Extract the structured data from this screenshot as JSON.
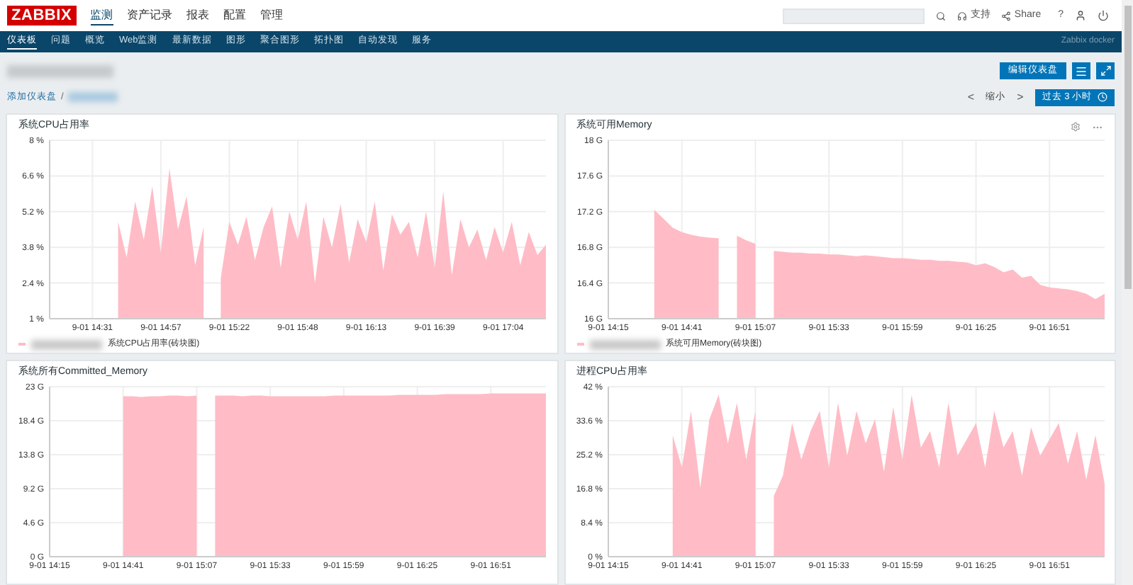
{
  "header": {
    "logo": "ZABBIX",
    "menu": [
      {
        "label": "监测",
        "selected": true
      },
      {
        "label": "资产记录",
        "selected": false
      },
      {
        "label": "报表",
        "selected": false
      },
      {
        "label": "配置",
        "selected": false
      },
      {
        "label": "管理",
        "selected": false
      }
    ],
    "support": "支持",
    "share": "Share",
    "help": "?"
  },
  "submenu": {
    "items": [
      {
        "label": "仪表板",
        "selected": true
      },
      {
        "label": "问题",
        "selected": false
      },
      {
        "label": "概览",
        "selected": false
      },
      {
        "label": "Web监测",
        "selected": false
      },
      {
        "label": "最新数据",
        "selected": false
      },
      {
        "label": "图形",
        "selected": false
      },
      {
        "label": "聚合图形",
        "selected": false
      },
      {
        "label": "拓扑图",
        "selected": false
      },
      {
        "label": "自动发现",
        "selected": false
      },
      {
        "label": "服务",
        "selected": false
      }
    ],
    "server_name": "Zabbix docker"
  },
  "toolbar": {
    "edit_button": "编辑仪表盘"
  },
  "breadcrumb": {
    "root": "添加仪表盘",
    "separator": "/"
  },
  "timeline": {
    "prev": "<",
    "zoom_out": "缩小",
    "next": ">",
    "range": "过去 3 小时"
  },
  "widgets": [
    {
      "title": "系统CPU占用率",
      "chart_data": {
        "type": "area",
        "grid": true,
        "categories": [
          null,
          null,
          null,
          null,
          null,
          "9-01 14:31",
          null,
          null,
          null,
          null,
          null,
          null,
          null,
          "9-01 14:57",
          null,
          null,
          null,
          null,
          null,
          null,
          null,
          "9-01 15:22",
          null,
          null,
          null,
          null,
          null,
          null,
          null,
          "9-01 15:48",
          null,
          null,
          null,
          null,
          null,
          null,
          null,
          "9-01 16:13",
          null,
          null,
          null,
          null,
          null,
          null,
          null,
          "9-01 16:39",
          null,
          null,
          null,
          null,
          null,
          null,
          null,
          "9-01 17:04",
          null,
          null,
          null,
          null,
          null
        ],
        "series": [
          {
            "name": "系统CPU占用率(砖块图)",
            "color": "#ffbcc6",
            "values": [
              null,
              null,
              null,
              null,
              null,
              null,
              null,
              null,
              4.8,
              3.4,
              5.6,
              4.1,
              6.2,
              3.6,
              6.9,
              4.5,
              5.8,
              3.1,
              4.6,
              null,
              2.6,
              4.8,
              3.9,
              5.0,
              3.3,
              4.6,
              5.4,
              3.0,
              5.2,
              4.1,
              5.6,
              2.4,
              5.0,
              3.8,
              5.5,
              3.2,
              4.9,
              4.0,
              5.6,
              2.9,
              5.1,
              4.3,
              4.8,
              3.4,
              5.2,
              3.0,
              6.0,
              2.7,
              4.9,
              3.8,
              4.5,
              3.3,
              4.6,
              3.6,
              4.8,
              3.1,
              4.4,
              3.5,
              3.9
            ]
          }
        ],
        "ylim": [
          1,
          8
        ],
        "yticks": [
          {
            "value": 1,
            "label": "1 %"
          },
          {
            "value": 2.4,
            "label": "2.4 %"
          },
          {
            "value": 3.8,
            "label": "3.8 %"
          },
          {
            "value": 5.2,
            "label": "5.2 %"
          },
          {
            "value": 6.6,
            "label": "6.6 %"
          },
          {
            "value": 8,
            "label": "8 %"
          }
        ]
      }
    },
    {
      "title": "系统可用Memory",
      "menu": true,
      "chart_data": {
        "type": "area",
        "grid": true,
        "categories": [
          "9-01 14:15",
          null,
          null,
          null,
          null,
          null,
          null,
          null,
          "9-01 14:41",
          null,
          null,
          null,
          null,
          null,
          null,
          null,
          "9-01 15:07",
          null,
          null,
          null,
          null,
          null,
          null,
          null,
          "9-01 15:33",
          null,
          null,
          null,
          null,
          null,
          null,
          null,
          "9-01 15:59",
          null,
          null,
          null,
          null,
          null,
          null,
          null,
          "9-01 16:25",
          null,
          null,
          null,
          null,
          null,
          null,
          null,
          "9-01 16:51",
          null,
          null,
          null,
          null,
          null,
          null
        ],
        "series": [
          {
            "name": "系统可用Memory(砖块图)",
            "color": "#ffbcc6",
            "values": [
              null,
              null,
              null,
              null,
              null,
              17.22,
              17.12,
              17.02,
              16.97,
              16.94,
              16.92,
              16.91,
              16.9,
              null,
              16.93,
              16.88,
              16.84,
              null,
              16.76,
              16.75,
              16.74,
              16.74,
              16.73,
              16.73,
              16.72,
              16.72,
              16.71,
              16.7,
              16.71,
              16.7,
              16.69,
              16.68,
              16.68,
              16.67,
              16.66,
              16.66,
              16.65,
              16.65,
              16.64,
              16.63,
              16.6,
              16.62,
              16.58,
              16.52,
              16.55,
              16.46,
              16.48,
              16.38,
              16.35,
              16.34,
              16.33,
              16.31,
              16.28,
              16.22,
              16.28
            ]
          }
        ],
        "ylim": [
          16,
          18
        ],
        "yticks": [
          {
            "value": 16,
            "label": "16 G"
          },
          {
            "value": 16.4,
            "label": "16.4 G"
          },
          {
            "value": 16.8,
            "label": "16.8 G"
          },
          {
            "value": 17.2,
            "label": "17.2 G"
          },
          {
            "value": 17.6,
            "label": "17.6 G"
          },
          {
            "value": 18,
            "label": "18 G"
          }
        ]
      }
    },
    {
      "title": "系统所有Committed_Memory",
      "chart_data": {
        "type": "area",
        "grid": true,
        "categories": [
          "9-01 14:15",
          null,
          null,
          null,
          null,
          null,
          null,
          null,
          "9-01 14:41",
          null,
          null,
          null,
          null,
          null,
          null,
          null,
          "9-01 15:07",
          null,
          null,
          null,
          null,
          null,
          null,
          null,
          "9-01 15:33",
          null,
          null,
          null,
          null,
          null,
          null,
          null,
          "9-01 15:59",
          null,
          null,
          null,
          null,
          null,
          null,
          null,
          "9-01 16:25",
          null,
          null,
          null,
          null,
          null,
          null,
          null,
          "9-01 16:51",
          null,
          null,
          null,
          null,
          null,
          null
        ],
        "series": [
          {
            "color": "#ffbcc6",
            "values": [
              null,
              null,
              null,
              null,
              null,
              null,
              null,
              null,
              21.7,
              21.7,
              21.6,
              21.7,
              21.7,
              21.8,
              21.8,
              21.7,
              21.8,
              null,
              21.8,
              21.8,
              21.8,
              21.7,
              21.8,
              21.8,
              21.7,
              21.7,
              21.7,
              21.7,
              21.7,
              21.7,
              21.7,
              21.8,
              21.8,
              21.8,
              21.8,
              21.8,
              21.8,
              21.8,
              21.9,
              21.9,
              21.9,
              21.9,
              21.9,
              22.0,
              22.0,
              22.0,
              22.0,
              22.0,
              22.1,
              22.1,
              22.1,
              22.1,
              22.1,
              22.1,
              22.1
            ]
          }
        ],
        "ylim": [
          0,
          23
        ],
        "yticks": [
          {
            "value": 0,
            "label": "0 G"
          },
          {
            "value": 4.6,
            "label": "4.6 G"
          },
          {
            "value": 9.2,
            "label": "9.2 G"
          },
          {
            "value": 13.8,
            "label": "13.8 G"
          },
          {
            "value": 18.4,
            "label": "18.4 G"
          },
          {
            "value": 23,
            "label": "23 G"
          }
        ]
      }
    },
    {
      "title": "进程CPU占用率",
      "chart_data": {
        "type": "area",
        "grid": true,
        "categories": [
          "9-01 14:15",
          null,
          null,
          null,
          null,
          null,
          null,
          null,
          "9-01 14:41",
          null,
          null,
          null,
          null,
          null,
          null,
          null,
          "9-01 15:07",
          null,
          null,
          null,
          null,
          null,
          null,
          null,
          "9-01 15:33",
          null,
          null,
          null,
          null,
          null,
          null,
          null,
          "9-01 15:59",
          null,
          null,
          null,
          null,
          null,
          null,
          null,
          "9-01 16:25",
          null,
          null,
          null,
          null,
          null,
          null,
          null,
          "9-01 16:51",
          null,
          null,
          null,
          null,
          null,
          null
        ],
        "series": [
          {
            "color": "#ffbcc6",
            "values": [
              null,
              null,
              null,
              null,
              null,
              null,
              null,
              30,
              22,
              36,
              17,
              34,
              40,
              28,
              38,
              24,
              36,
              null,
              15,
              20,
              33,
              24,
              31,
              36,
              22,
              38,
              25,
              36,
              28,
              34,
              21,
              37,
              24,
              40,
              27,
              31,
              22,
              38,
              25,
              29,
              33,
              22,
              36,
              27,
              31,
              20,
              32,
              25,
              29,
              33,
              23,
              31,
              19,
              30,
              18
            ]
          }
        ],
        "ylim": [
          0,
          42
        ],
        "yticks": [
          {
            "value": 0,
            "label": "0 %"
          },
          {
            "value": 8.4,
            "label": "8.4 %"
          },
          {
            "value": 16.8,
            "label": "16.8 %"
          },
          {
            "value": 25.2,
            "label": "25.2 %"
          },
          {
            "value": 33.6,
            "label": "33.6 %"
          },
          {
            "value": 42,
            "label": "42 %"
          }
        ]
      }
    }
  ]
}
